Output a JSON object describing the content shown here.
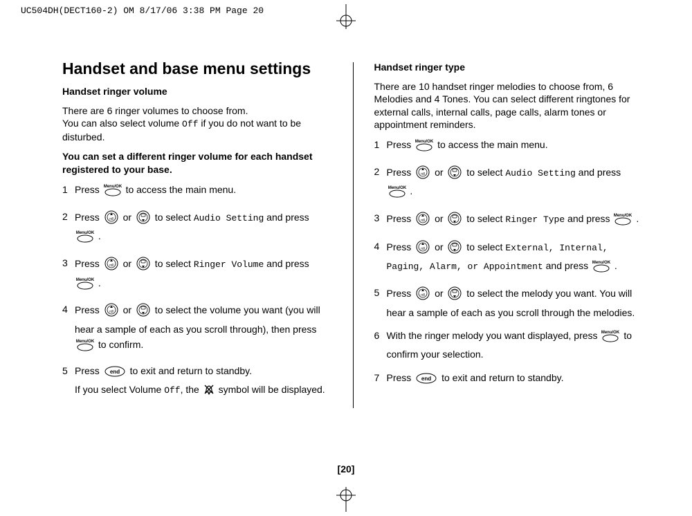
{
  "slug": "UC504DH(DECT160-2) OM  8/17/06  3:38 PM  Page 20",
  "page_number": "[20]",
  "left": {
    "title": "Handset and base menu settings",
    "sec1_title": "Handset ringer volume",
    "intro1": "There are 6 ringer volumes to choose from.",
    "intro2a": "You can also select volume ",
    "intro2b": " if you do not want to be disturbed.",
    "off": "Off",
    "note": "You can set a different ringer volume for each handset registered to your base.",
    "s1a": "Press ",
    "s1b": " to access the main menu.",
    "s2a": "Press ",
    "s2_or": " or ",
    "s2b": " to select ",
    "s2_menu": "Audio Setting",
    "s2c": " and press ",
    "s3a": "Press ",
    "s3b": " to select ",
    "s3_menu": "Ringer Volume",
    "s3c": " and press ",
    "s4a": "Press ",
    "s4b": " to select the volume you want (you will hear a sample of each as you scroll through), then press ",
    "s4c": " to confirm.",
    "s5a": "Press ",
    "s5b": " to exit and return to standby.",
    "s5c": "If you select Volume ",
    "s5d": ", the ",
    "s5e": " symbol will be displayed.",
    "period": " ."
  },
  "right": {
    "sec_title": "Handset ringer type",
    "intro": "There are 10 handset ringer melodies to choose from, 6 Melodies and 4 Tones. You can select different ringtones for external calls, internal calls, page calls, alarm tones or appointment reminders.",
    "s1a": "Press ",
    "s1b": " to access the main menu.",
    "s2a": "Press ",
    "or": " or ",
    "s2b": " to select ",
    "s2_menu": "Audio Setting",
    "and_press": " and press ",
    "period": " .",
    "s3a": "Press ",
    "s3b": " to select ",
    "s3_menu": "Ringer Type",
    "s4a": "Press ",
    "s4b": " to select ",
    "s4_menus": "External, Internal, Paging, Alarm, or Appointment",
    "s5a": "Press ",
    "s5b": " to select the melody you want. You will hear a sample of each as you scroll through the melodies.",
    "s6a": "With the ringer melody you want displayed, press ",
    "s6b": " to confirm your selection.",
    "s7a": "Press ",
    "s7b": " to exit and return to standby."
  }
}
